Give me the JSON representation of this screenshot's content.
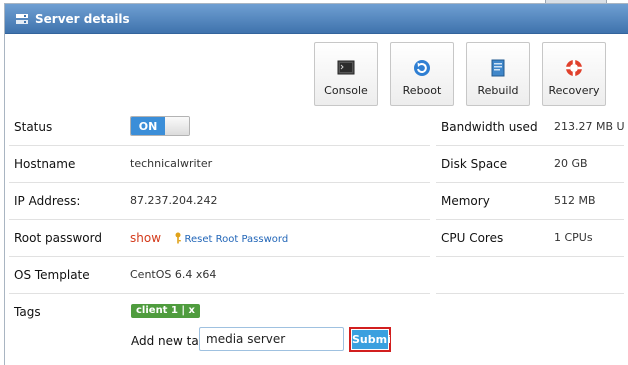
{
  "window": {
    "title": "Server details",
    "title_icon": "server-icon"
  },
  "actions": [
    {
      "label": "Console",
      "icon": "console-icon"
    },
    {
      "label": "Reboot",
      "icon": "reboot-icon"
    },
    {
      "label": "Rebuild",
      "icon": "rebuild-icon"
    },
    {
      "label": "Recovery",
      "icon": "recovery-icon"
    }
  ],
  "details": {
    "status": {
      "label": "Status",
      "toggle_on": "ON"
    },
    "hostname": {
      "label": "Hostname",
      "value": "technicalwriter"
    },
    "ip": {
      "label": "IP Address:",
      "value": "87.237.204.242"
    },
    "root_password": {
      "label": "Root password",
      "show_link": "show",
      "reset_link": "Reset Root Password"
    },
    "os_template": {
      "label": "OS Template",
      "value": "CentOS 6.4 x64"
    },
    "tags": {
      "label": "Tags",
      "badge": "client 1 | x",
      "add_label": "Add new tag:",
      "input_value": "media server",
      "submit_label": "Submit"
    }
  },
  "resources": {
    "bandwidth": {
      "label": "Bandwidth used",
      "value": "213.27 MB U"
    },
    "disk": {
      "label": "Disk Space",
      "value": "20 GB"
    },
    "memory": {
      "label": "Memory",
      "value": "512 MB"
    },
    "cpu": {
      "label": "CPU Cores",
      "value": "1 CPUs"
    }
  },
  "colors": {
    "titlebar": "#4a80bd",
    "toggle_on": "#3b8ed8",
    "tag_badge": "#4f9c3e",
    "submit": "#3aa0df",
    "highlight": "#d21f1f",
    "show_link": "#d43b1c"
  }
}
